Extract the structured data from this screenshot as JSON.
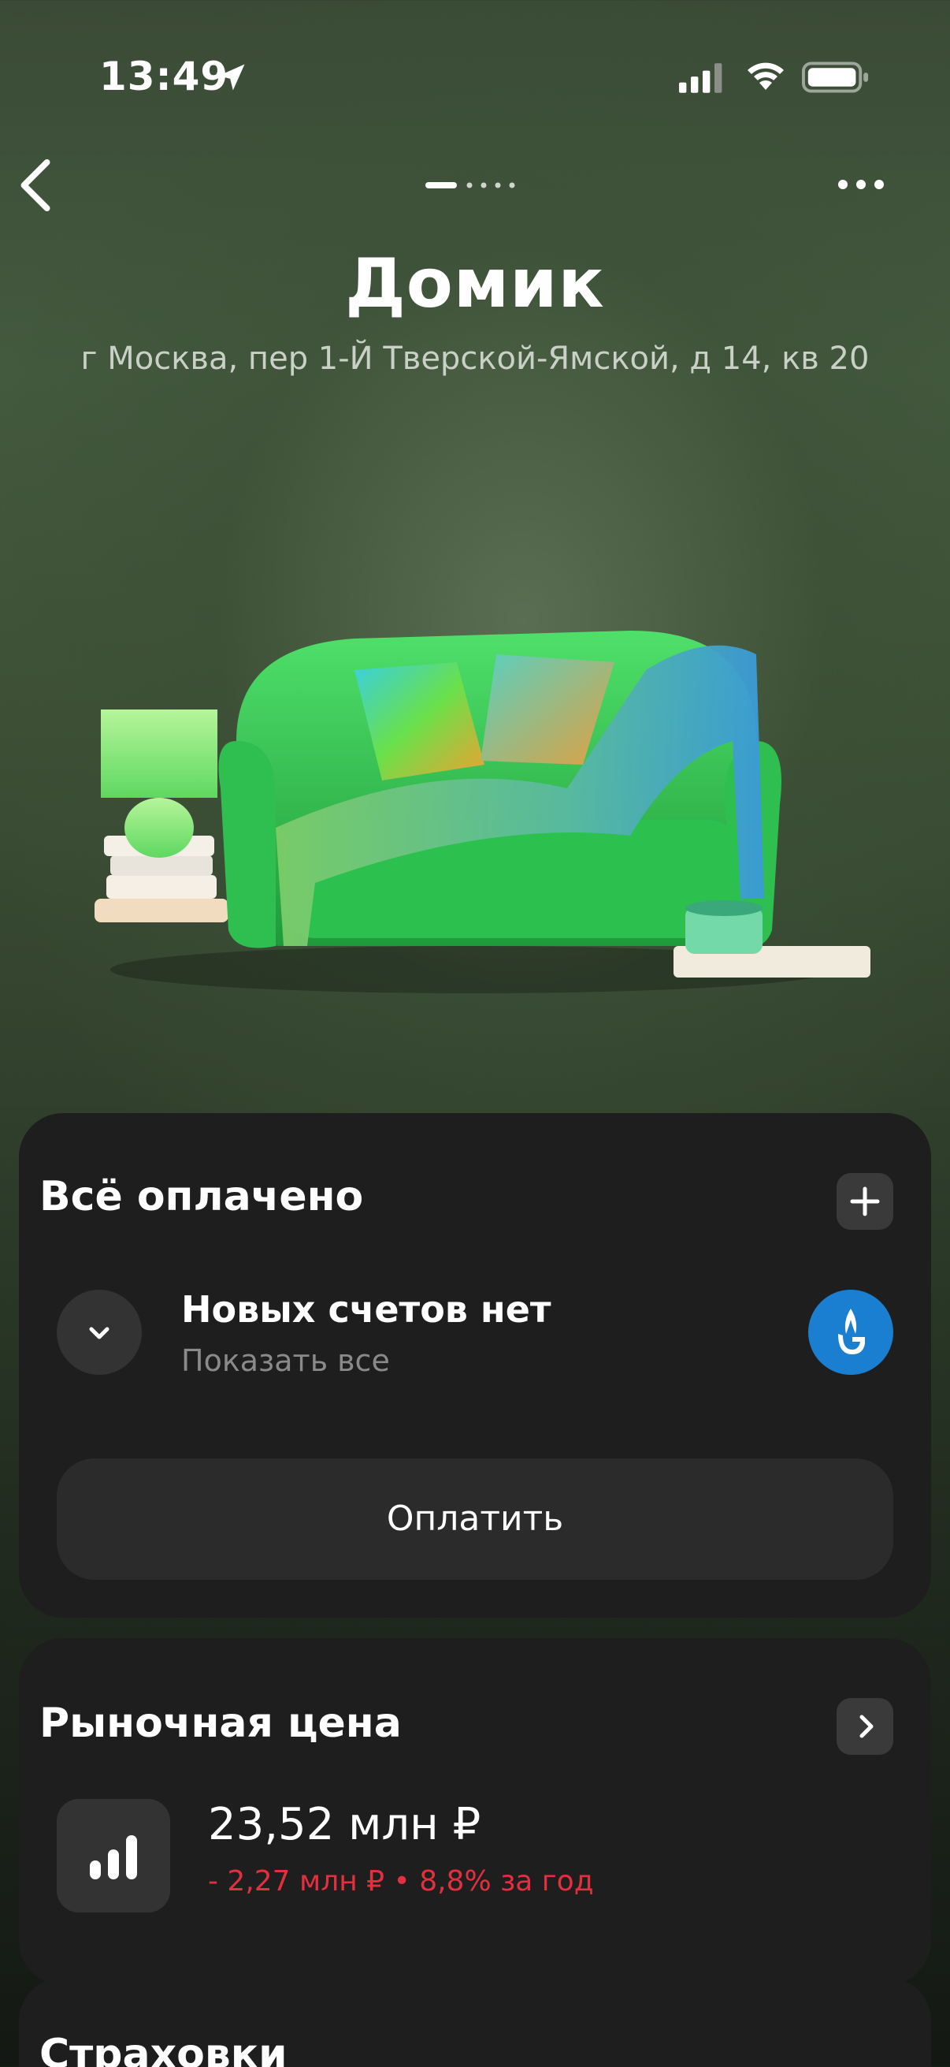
{
  "status_bar": {
    "time": "13:49",
    "icons": [
      "location-arrow-icon",
      "cellular-signal-icon",
      "wifi-icon",
      "battery-icon"
    ]
  },
  "nav": {
    "back_icon": "chevron-left-icon",
    "more_icon": "more-horizontal-icon",
    "page_count": 5,
    "active_page": 1
  },
  "header": {
    "title": "Домик",
    "address": "г Москва, пер 1-Й Тверской-Ямской, д 14, кв 20"
  },
  "payments_card": {
    "title": "Всё оплачено",
    "add_icon": "plus-icon",
    "bills_title": "Новых счетов нет",
    "bills_subtitle": "Показать все",
    "expand_icon": "chevron-down-icon",
    "provider_icon": "gazprom-logo-icon",
    "pay_button": "Оплатить"
  },
  "market_price_card": {
    "title": "Рыночная цена",
    "open_icon": "chevron-right-icon",
    "stats_icon": "bar-chart-icon",
    "value": "23,52 млн ₽",
    "change": "- 2,27 млн ₽ • 8,8% за год"
  },
  "insurance_card": {
    "title": "Страховки"
  },
  "colors": {
    "background_top": "#3a4a36",
    "card": "#1e1e1e",
    "negative": "#e3303f",
    "provider_blue": "#1a7fd1"
  }
}
